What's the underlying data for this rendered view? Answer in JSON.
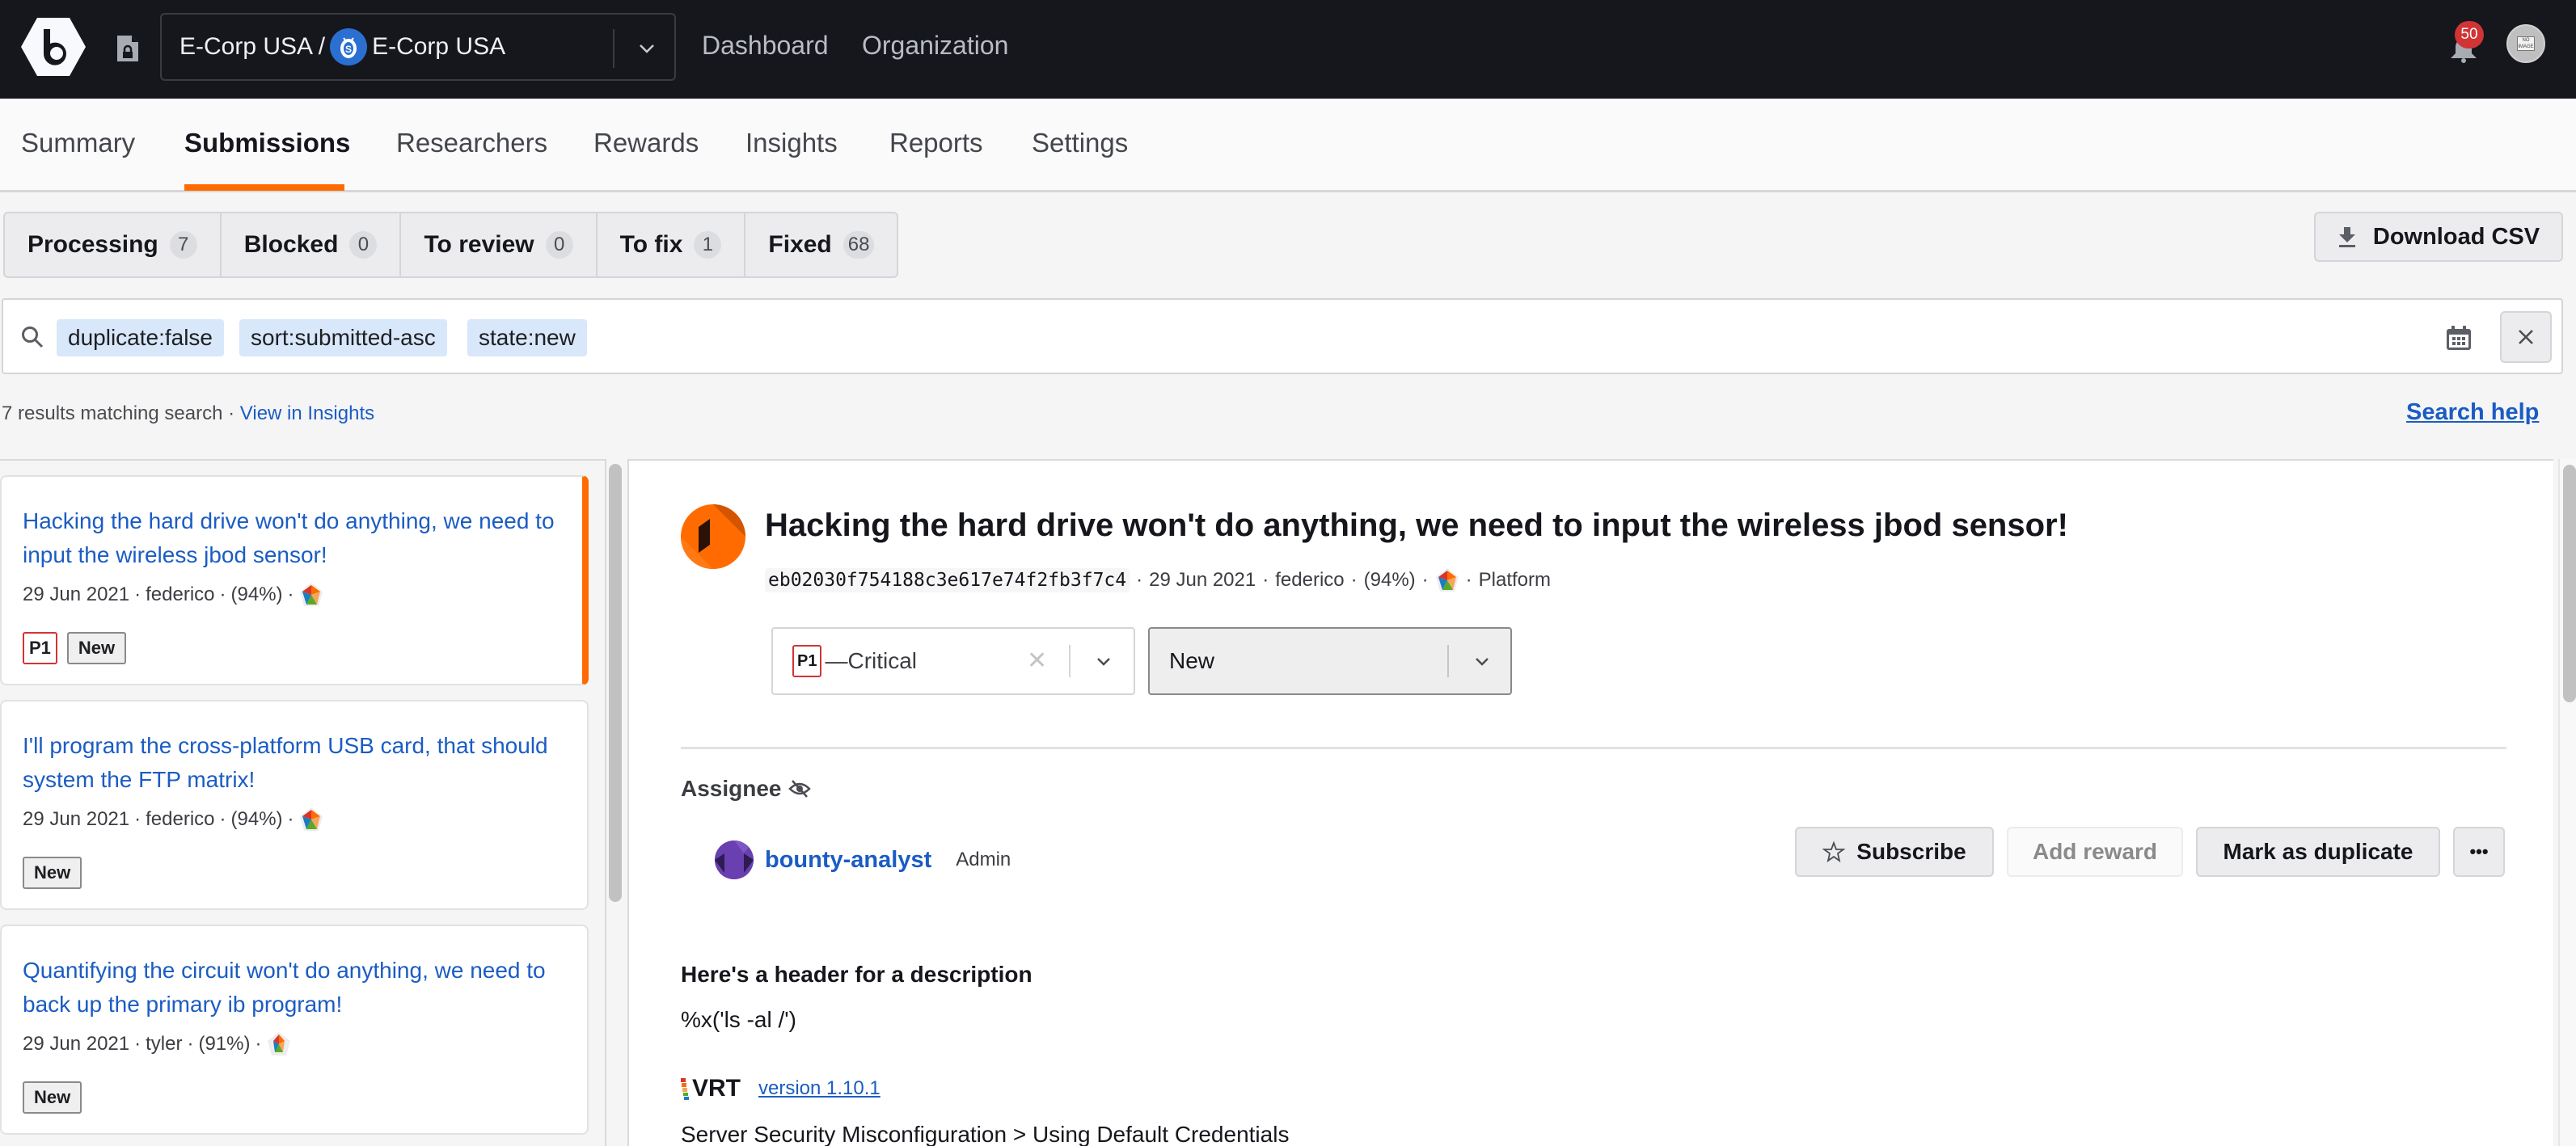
{
  "topbar": {
    "org_parent": "E-Corp USA /",
    "org_name": "E-Corp USA",
    "nav": [
      "Dashboard",
      "Organization"
    ],
    "notifications_count": "50",
    "avatar_text": "NO IMAGE"
  },
  "subnav": {
    "tabs": [
      "Summary",
      "Submissions",
      "Researchers",
      "Rewards",
      "Insights",
      "Reports",
      "Settings"
    ],
    "active": "Submissions"
  },
  "status_tabs": [
    {
      "label": "Processing",
      "count": "7"
    },
    {
      "label": "Blocked",
      "count": "0"
    },
    {
      "label": "To review",
      "count": "0"
    },
    {
      "label": "To fix",
      "count": "1"
    },
    {
      "label": "Fixed",
      "count": "68"
    }
  ],
  "download_csv": "Download CSV",
  "search": {
    "chips": [
      "duplicate:false",
      "sort:submitted-asc",
      "state:new"
    ]
  },
  "results": {
    "summary": "7 results matching search",
    "separator": " · ",
    "insights_link": "View in Insights",
    "search_help": "Search help"
  },
  "submissions": [
    {
      "title": "Hacking the hard drive won't do anything, we need to input the wireless jbod sensor!",
      "date": "29 Jun 2021",
      "researcher": "federico",
      "score": "(94%)",
      "priority": "P1",
      "state": "New",
      "selected": true
    },
    {
      "title": "I'll program the cross-platform USB card, that should system the FTP matrix!",
      "date": "29 Jun 2021",
      "researcher": "federico",
      "score": "(94%)",
      "priority": null,
      "state": "New",
      "selected": false
    },
    {
      "title": "Quantifying the circuit won't do anything, we need to back up the primary ib program!",
      "date": "29 Jun 2021",
      "researcher": "tyler",
      "score": "(91%)",
      "priority": null,
      "state": "New",
      "selected": false
    }
  ],
  "detail": {
    "title": "Hacking the hard drive won't do anything, we need to input the wireless jbod sensor!",
    "hash": "eb02030f754188c3e617e74f2fb3f7c4",
    "date": "29 Jun 2021",
    "researcher": "federico",
    "score": "(94%)",
    "target": "Platform",
    "severity": {
      "badge": "P1",
      "label": "—Critical"
    },
    "state_value": "New",
    "assignee_label": "Assignee",
    "assignee": {
      "name": "bounty-analyst",
      "role": "Admin"
    },
    "buttons": {
      "subscribe": "Subscribe",
      "add_reward": "Add reward",
      "mark_duplicate": "Mark as duplicate",
      "more": "•••"
    },
    "description_header": "Here's a header for a description",
    "description_code": "%x('ls -al /')",
    "vrt_logo": "VRT",
    "vrt_version": "version 1.10.1",
    "vrt_category": "Server Security Misconfiguration > Using Default Credentials"
  },
  "colors": {
    "accent": "#ff6b00",
    "link": "#1b5cc4",
    "topbar": "#15171c",
    "chip": "#d8e7fa",
    "p1_border": "#d13434"
  }
}
